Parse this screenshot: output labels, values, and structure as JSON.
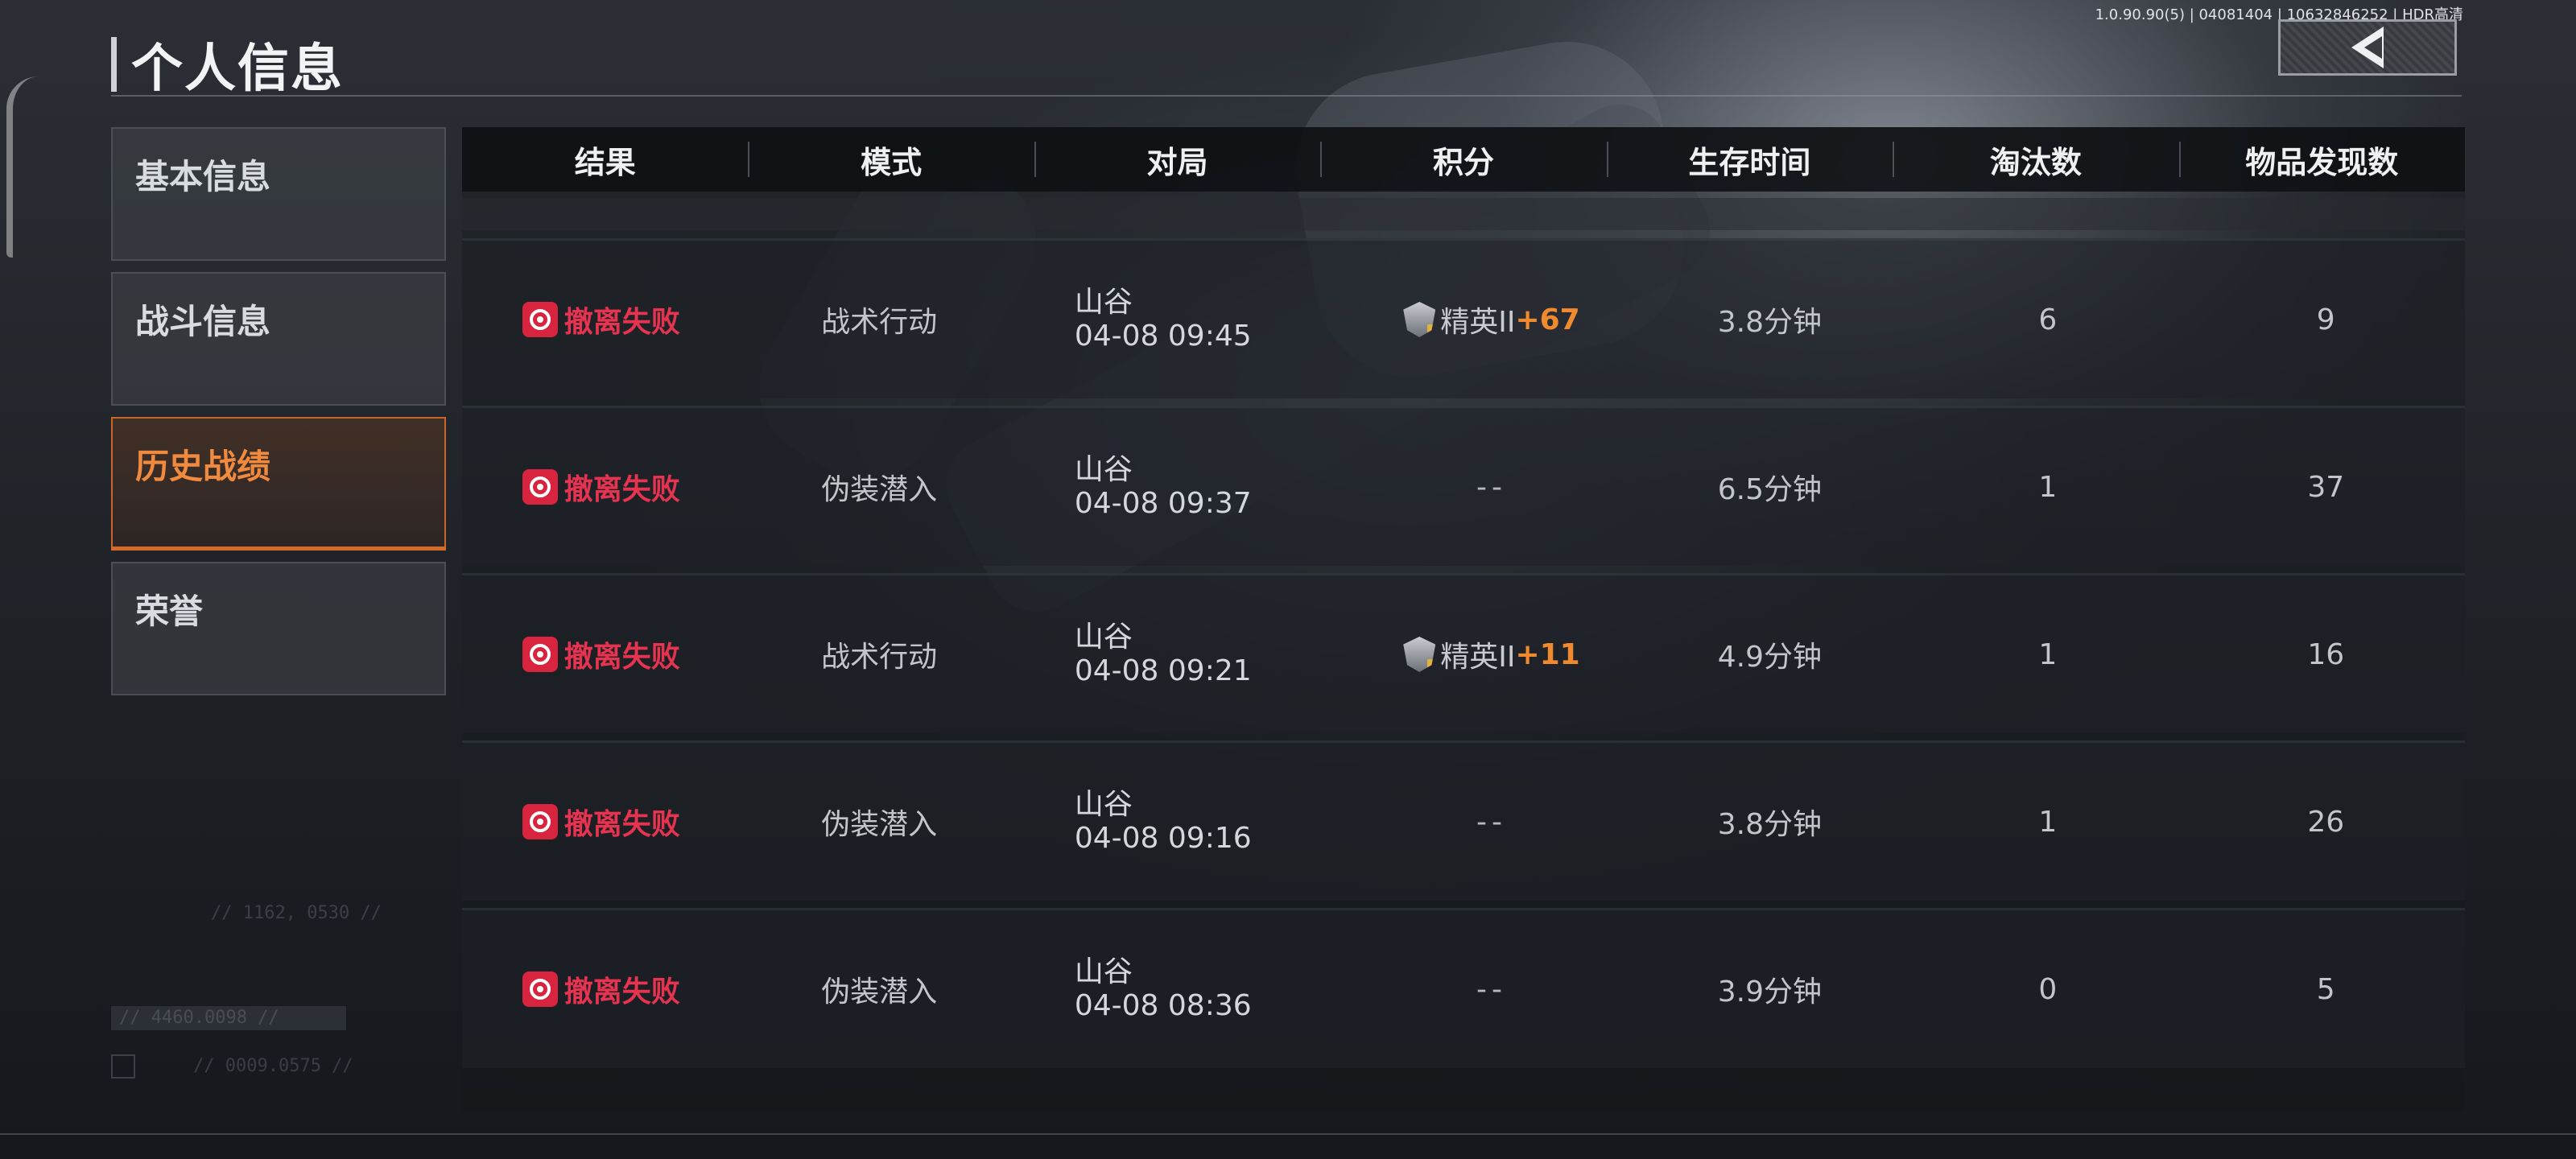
{
  "header": {
    "title": "个人信息",
    "build_info": "1.0.90.90(5) | 04081404 | 10632846252 | HDR高清",
    "back_icon": "chevron-left-icon"
  },
  "sidebar": {
    "items": [
      {
        "label": "基本信息",
        "active": false
      },
      {
        "label": "战斗信息",
        "active": false
      },
      {
        "label": "历史战绩",
        "active": true
      },
      {
        "label": "荣誉",
        "active": false
      }
    ]
  },
  "ghost": {
    "coord1": "// 1162, 0530 //",
    "coord2": "// 4460.0098 //",
    "coord3": "// 0009.0575 //"
  },
  "table": {
    "columns": [
      "结果",
      "模式",
      "对局",
      "积分",
      "生存时间",
      "淘汰数",
      "物品发现数"
    ],
    "rows": [
      {
        "result": "撤离失败",
        "mode": "战术行动",
        "map": "山谷",
        "time": "04-08 09:45",
        "rank_name": "精英II",
        "rank_delta": "+67",
        "score": "",
        "survival": "3.8分钟",
        "eliminations": "6",
        "items_found": "9"
      },
      {
        "result": "撤离失败",
        "mode": "伪装潜入",
        "map": "山谷",
        "time": "04-08 09:37",
        "rank_name": "",
        "rank_delta": "",
        "score": "--",
        "survival": "6.5分钟",
        "eliminations": "1",
        "items_found": "37"
      },
      {
        "result": "撤离失败",
        "mode": "战术行动",
        "map": "山谷",
        "time": "04-08 09:21",
        "rank_name": "精英II",
        "rank_delta": "+11",
        "score": "",
        "survival": "4.9分钟",
        "eliminations": "1",
        "items_found": "16"
      },
      {
        "result": "撤离失败",
        "mode": "伪装潜入",
        "map": "山谷",
        "time": "04-08 09:16",
        "rank_name": "",
        "rank_delta": "",
        "score": "--",
        "survival": "3.8分钟",
        "eliminations": "1",
        "items_found": "26"
      },
      {
        "result": "撤离失败",
        "mode": "伪装潜入",
        "map": "山谷",
        "time": "04-08 08:36",
        "rank_name": "",
        "rank_delta": "",
        "score": "--",
        "survival": "3.9分钟",
        "eliminations": "0",
        "items_found": "5"
      }
    ]
  },
  "colors": {
    "accent": "#d66a2a",
    "fail_red": "#e6334f",
    "rank_gain": "#f08a2e"
  }
}
